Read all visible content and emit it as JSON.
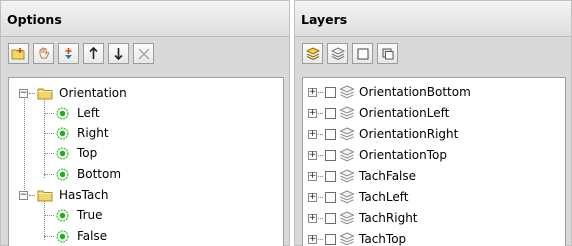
{
  "options": {
    "title": "Options",
    "toolbar": [
      {
        "icon": "add-folder-icon"
      },
      {
        "icon": "hand-icon"
      },
      {
        "icon": "add-item-icon"
      },
      {
        "icon": "arrow-up-icon"
      },
      {
        "icon": "arrow-down-icon"
      },
      {
        "icon": "delete-icon"
      }
    ],
    "groups": [
      {
        "label": "Orientation",
        "items": [
          "Left",
          "Right",
          "Top",
          "Bottom"
        ]
      },
      {
        "label": "HasTach",
        "items": [
          "True",
          "False"
        ]
      }
    ]
  },
  "layers": {
    "title": "Layers",
    "toolbar": [
      {
        "icon": "layers-icon"
      },
      {
        "icon": "layers-outline-icon"
      },
      {
        "icon": "square-icon"
      },
      {
        "icon": "duplicate-icon"
      }
    ],
    "items": [
      "OrientationBottom",
      "OrientationLeft",
      "OrientationRight",
      "OrientationTop",
      "TachFalse",
      "TachLeft",
      "TachRight",
      "TachTop"
    ]
  },
  "colors": {
    "radio_green": "#1fae1f",
    "folder_yellow": "#f3d66a"
  }
}
